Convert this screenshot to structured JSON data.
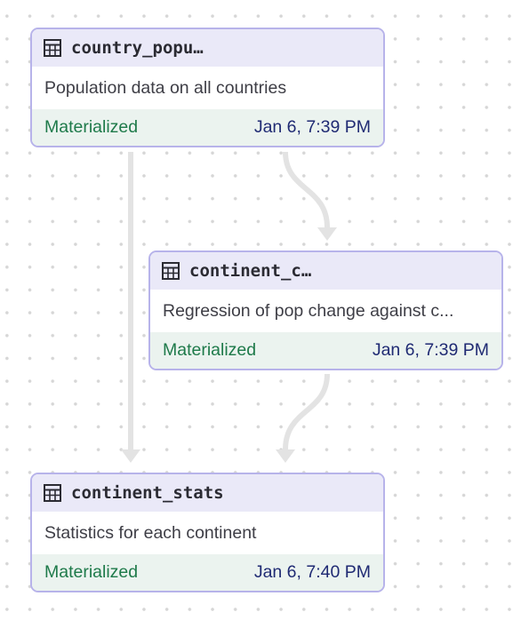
{
  "nodes": [
    {
      "title": "country_popu…",
      "description": "Population data on all countries",
      "status": "Materialized",
      "timestamp": "Jan 6, 7:39 PM",
      "icon": "table-icon"
    },
    {
      "title": "continent_c…",
      "description": "Regression of pop change against c...",
      "status": "Materialized",
      "timestamp": "Jan 6, 7:39 PM",
      "icon": "table-icon"
    },
    {
      "title": "continent_stats",
      "description": "Statistics for each continent",
      "status": "Materialized",
      "timestamp": "Jan 6, 7:40 PM",
      "icon": "table-icon"
    }
  ],
  "edges": [
    {
      "from": "country_popu…",
      "to": "continent_c…"
    },
    {
      "from": "country_popu…",
      "to": "continent_stats"
    },
    {
      "from": "continent_c…",
      "to": "continent_stats"
    }
  ],
  "colors": {
    "node_border": "#b7b3ea",
    "header_bg": "#eae9f8",
    "footer_bg": "#ebf3ef",
    "status_text": "#1e7a4a",
    "timestamp_text": "#1f2a73",
    "edge": "#e3e3e3",
    "grid_dot": "#d6d6d6"
  }
}
